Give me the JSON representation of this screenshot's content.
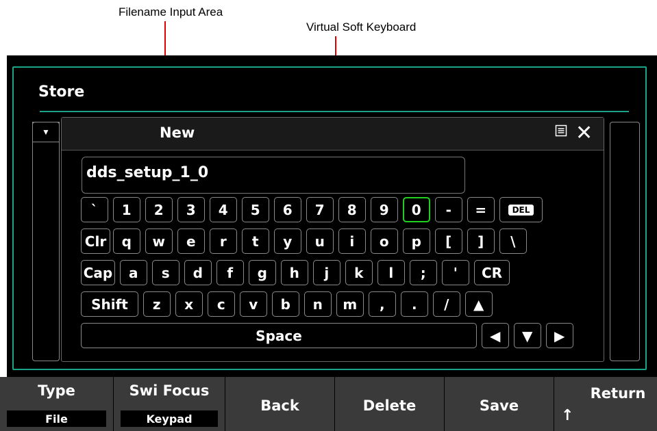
{
  "annotations": {
    "filename_input": "Filename Input Area",
    "soft_keyboard": "Virtual Soft Keyboard"
  },
  "store": {
    "title": "Store"
  },
  "dialog": {
    "title": "New",
    "menu_icon": "menu-icon",
    "close_icon": "close-icon",
    "filename_value": "dds_setup_1_0"
  },
  "keyboard": {
    "row1": [
      "`",
      "1",
      "2",
      "3",
      "4",
      "5",
      "6",
      "7",
      "8",
      "9",
      "0",
      "-",
      "=",
      "DEL"
    ],
    "row2": [
      "Clr",
      "q",
      "w",
      "e",
      "r",
      "t",
      "y",
      "u",
      "i",
      "o",
      "p",
      "[",
      "]",
      "\\"
    ],
    "row3": [
      "Cap",
      "a",
      "s",
      "d",
      "f",
      "g",
      "h",
      "j",
      "k",
      "l",
      ";",
      "'",
      "CR"
    ],
    "row4": [
      "Shift",
      "z",
      "x",
      "c",
      "v",
      "b",
      "n",
      "m",
      ",",
      ".",
      "/",
      "▲"
    ],
    "row5": [
      "Space",
      "◀",
      "▼",
      "▶"
    ],
    "focused_key": "0",
    "focus_color": "#22d022"
  },
  "softkeys": {
    "type_label": "Type",
    "type_value": "File",
    "swi_focus_label": "Swi Focus",
    "swi_focus_value": "Keypad",
    "back_label": "Back",
    "delete_label": "Delete",
    "save_label": "Save",
    "return_label": "Return"
  },
  "colors": {
    "accent": "#1aa58a",
    "annotation_arrow": "#e00000",
    "softkey_bg": "#3a3a3a"
  }
}
